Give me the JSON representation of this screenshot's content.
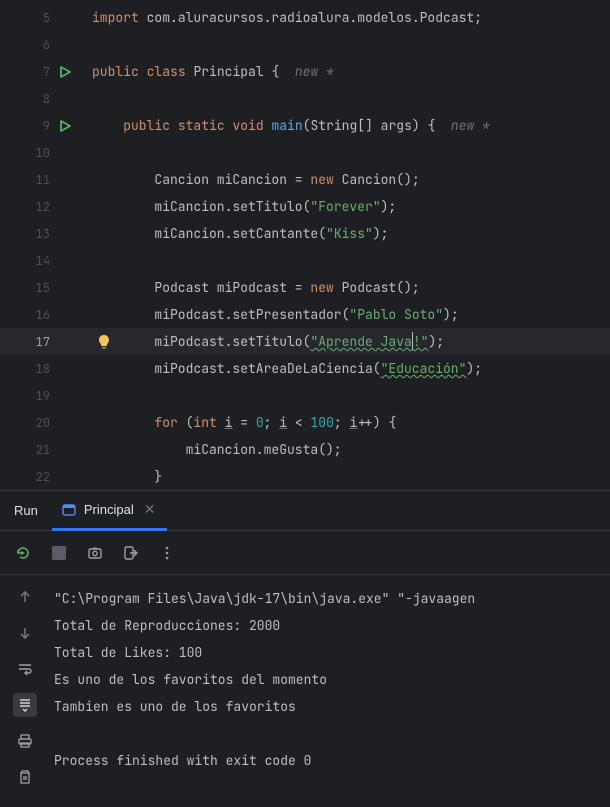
{
  "editor": {
    "lines": [
      {
        "n": 5,
        "run": false,
        "bulb": false,
        "current": false
      },
      {
        "n": 6,
        "run": false,
        "bulb": false,
        "current": false
      },
      {
        "n": 7,
        "run": true,
        "bulb": false,
        "current": false
      },
      {
        "n": 8,
        "run": false,
        "bulb": false,
        "current": false
      },
      {
        "n": 9,
        "run": true,
        "bulb": false,
        "current": false
      },
      {
        "n": 10,
        "run": false,
        "bulb": false,
        "current": false
      },
      {
        "n": 11,
        "run": false,
        "bulb": false,
        "current": false
      },
      {
        "n": 12,
        "run": false,
        "bulb": false,
        "current": false
      },
      {
        "n": 13,
        "run": false,
        "bulb": false,
        "current": false
      },
      {
        "n": 14,
        "run": false,
        "bulb": false,
        "current": false
      },
      {
        "n": 15,
        "run": false,
        "bulb": false,
        "current": false
      },
      {
        "n": 16,
        "run": false,
        "bulb": false,
        "current": false
      },
      {
        "n": 17,
        "run": false,
        "bulb": true,
        "current": true
      },
      {
        "n": 18,
        "run": false,
        "bulb": false,
        "current": false
      },
      {
        "n": 19,
        "run": false,
        "bulb": false,
        "current": false
      },
      {
        "n": 20,
        "run": false,
        "bulb": false,
        "current": false
      },
      {
        "n": 21,
        "run": false,
        "bulb": false,
        "current": false
      },
      {
        "n": 22,
        "run": false,
        "bulb": false,
        "current": false
      }
    ],
    "code": {
      "l5": {
        "kw1": "import",
        "pkg": " com.aluracursos.radioalura.modelos.Podcast;"
      },
      "l7": {
        "kw1": "public",
        "kw2": "class",
        "name": " Principal ",
        "brace": "{",
        "hint": "  new *"
      },
      "l9": {
        "indent": "    ",
        "kw1": "public",
        "kw2": "static",
        "kw3": "void",
        "fn": " main",
        "args": "(String[] args) ",
        "brace": "{",
        "hint": "  new *"
      },
      "l11": {
        "indent": "        ",
        "text1": "Cancion miCancion = ",
        "kw": "new",
        "text2": " Cancion();"
      },
      "l12": {
        "indent": "        ",
        "text1": "miCancion.setTitulo(",
        "str": "\"Forever\"",
        "text2": ");"
      },
      "l13": {
        "indent": "        ",
        "text1": "miCancion.setCantante(",
        "str": "\"Kiss\"",
        "text2": ");"
      },
      "l15": {
        "indent": "        ",
        "text1": "Podcast miPodcast = ",
        "kw": "new",
        "text2": " Podcast();"
      },
      "l16": {
        "indent": "        ",
        "text1": "miPodcast.setPresentador(",
        "str": "\"Pablo Soto\"",
        "text2": ");"
      },
      "l17": {
        "indent": "        ",
        "text1": "miPodcast.setTitulo(",
        "strA": "\"Aprende Java",
        "strB": "!\"",
        "text2": ");"
      },
      "l18": {
        "indent": "        ",
        "text1": "miPodcast.setAreaDeLaCiencia(",
        "str": "\"Educación\"",
        "text2": ");"
      },
      "l20": {
        "indent": "        ",
        "kw1": "for",
        "text1": " (",
        "kw2": "int",
        "var1": "i",
        "text2": " = ",
        "num1": "0",
        "text3": "; ",
        "var2": "i",
        "text4": " < ",
        "num2": "100",
        "text5": "; ",
        "var3": "i",
        "text6": "++) {"
      },
      "l21": {
        "indent": "            ",
        "text": "miCancion.meGusta();"
      },
      "l22": {
        "indent": "        ",
        "text": "}"
      }
    }
  },
  "run": {
    "title": "Run",
    "tab": {
      "label": "Principal"
    },
    "console": {
      "line1": "\"C:\\Program Files\\Java\\jdk-17\\bin\\java.exe\" \"-javaagen",
      "line2": "Total de Reproducciones: 2000",
      "line3": "Total de Likes: 100",
      "line4": "Es uno de los favoritos del momento",
      "line5": "Tambien es uno de los favoritos",
      "line6": "",
      "line7": "Process finished with exit code 0"
    }
  }
}
